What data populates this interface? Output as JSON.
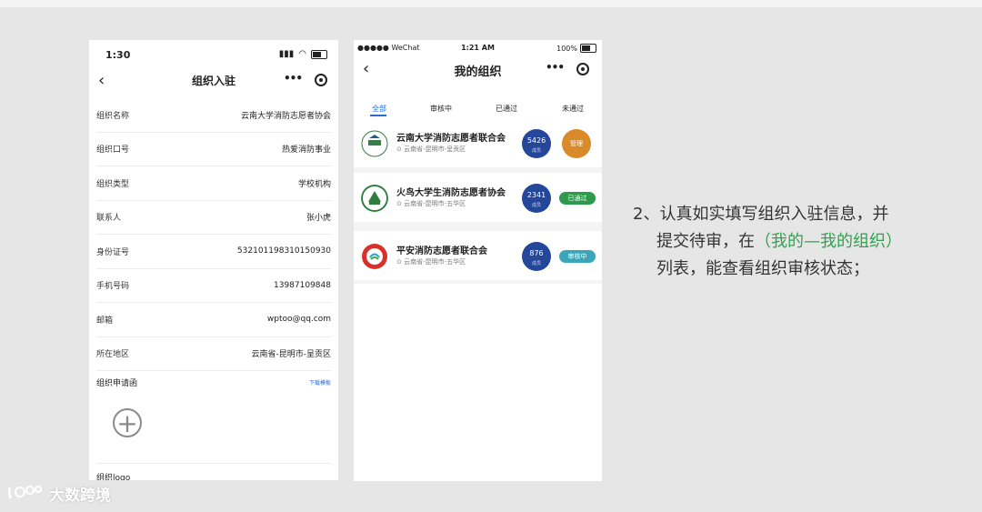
{
  "phone1": {
    "status": {
      "time": "1:30"
    },
    "nav": {
      "title": "组织入驻"
    },
    "rows": [
      {
        "label": "组织名称",
        "value": "云南大学消防志愿者协会"
      },
      {
        "label": "组织口号",
        "value": "热爱消防事业"
      },
      {
        "label": "组织类型",
        "value": "学校机构"
      },
      {
        "label": "联系人",
        "value": "张小虎"
      },
      {
        "label": "身份证号",
        "value": "532101198310150930"
      },
      {
        "label": "手机号码",
        "value": "13987109848"
      },
      {
        "label": "邮箱",
        "value": "wptoo@qq.com"
      },
      {
        "label": "所在地区",
        "value": "云南省-昆明市-呈贡区"
      }
    ],
    "attachment": {
      "label": "组织申请函",
      "link": "下载模板"
    },
    "logo_label": "组织logo"
  },
  "phone2": {
    "status": {
      "carrier": "●●●●● WeChat",
      "time": "1:21 AM",
      "battery": "100%"
    },
    "nav": {
      "title": "我的组织"
    },
    "tabs": [
      "全部",
      "审核中",
      "已通过",
      "未通过"
    ],
    "active_tab": "全部",
    "cards": [
      {
        "name": "云南大学消防志愿者联合会",
        "location": "云南省-昆明市-呈贡区",
        "count": "5426",
        "count_label": "成员",
        "action": "管理",
        "action_type": "manage"
      },
      {
        "name": "火鸟大学生消防志愿者协会",
        "location": "云南省-昆明市-五华区",
        "count": "2341",
        "count_label": "成员",
        "action": "已通过",
        "action_type": "approved"
      },
      {
        "name": "平安消防志愿者联合会",
        "location": "云南省-昆明市-五华区",
        "count": "876",
        "count_label": "成员",
        "action": "审核中",
        "action_type": "reviewing"
      }
    ]
  },
  "caption": {
    "line1": "2、认真如实填写组织入驻信息，并",
    "line2_pre": "提交待审，在",
    "line2_highlight": "（我的—我的组织）",
    "line3": "列表，能查看组织审核状态；"
  },
  "watermark": {
    "text": "大数跨境"
  },
  "colors": {
    "accent_blue": "#2a6bd6",
    "count_circle": "#24479a",
    "manage": "#d98a2a",
    "approved": "#2e9a4b",
    "reviewing": "#3ba6b9",
    "highlight": "#2fa24d"
  }
}
